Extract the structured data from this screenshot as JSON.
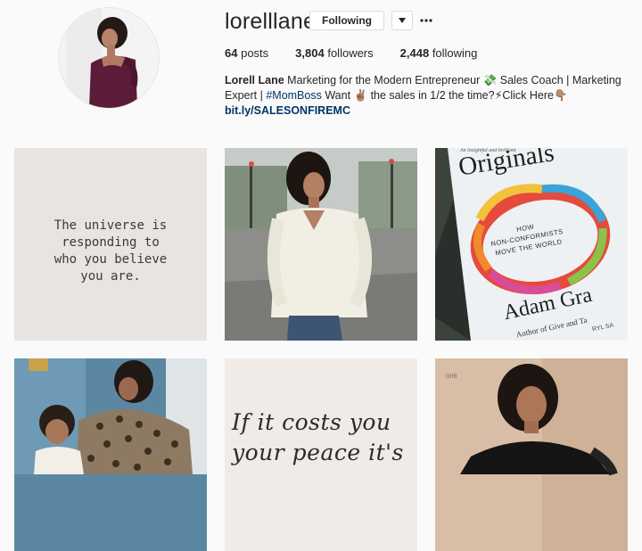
{
  "profile": {
    "username": "lorelllane",
    "following_label": "Following"
  },
  "stats": {
    "posts_count": "64",
    "posts_label": "posts",
    "followers_count": "3,804",
    "followers_label": "followers",
    "following_count": "2,448",
    "following_label": "following"
  },
  "bio": {
    "name": "Lorell Lane",
    "line1_a": " Marketing for the Modern Entrepreneur ",
    "emoji_money": "💸",
    "line1_b": " Sales Coach | Marketing",
    "line2_a": "Expert | ",
    "hashtag": "#MomBoss",
    "line2_b": " Want ",
    "emoji_peace": "✌🏽",
    "line2_c": " the sales in 1/2 the time?",
    "emoji_bolt": "⚡",
    "line2_d": "Click Here",
    "emoji_point": "👇🏽",
    "link": "bit.ly/SALESONFIREMC"
  },
  "posts": {
    "quote1": [
      "The universe is",
      "responding to",
      "who you believe",
      "you are."
    ],
    "book_title": "Originals",
    "book_subtitle": [
      "HOW",
      "NON-CONFORMISTS",
      "MOVE THE WORLD"
    ],
    "book_author": "Adam Gra",
    "book_top_small": "An insightful and brilliant",
    "book_bottom_small": "Author of Give and Ta",
    "book_bottom_right": "RYL SA",
    "quote2": [
      "If it costs you",
      "your peace it's"
    ],
    "tile7_sign": "QHB"
  }
}
